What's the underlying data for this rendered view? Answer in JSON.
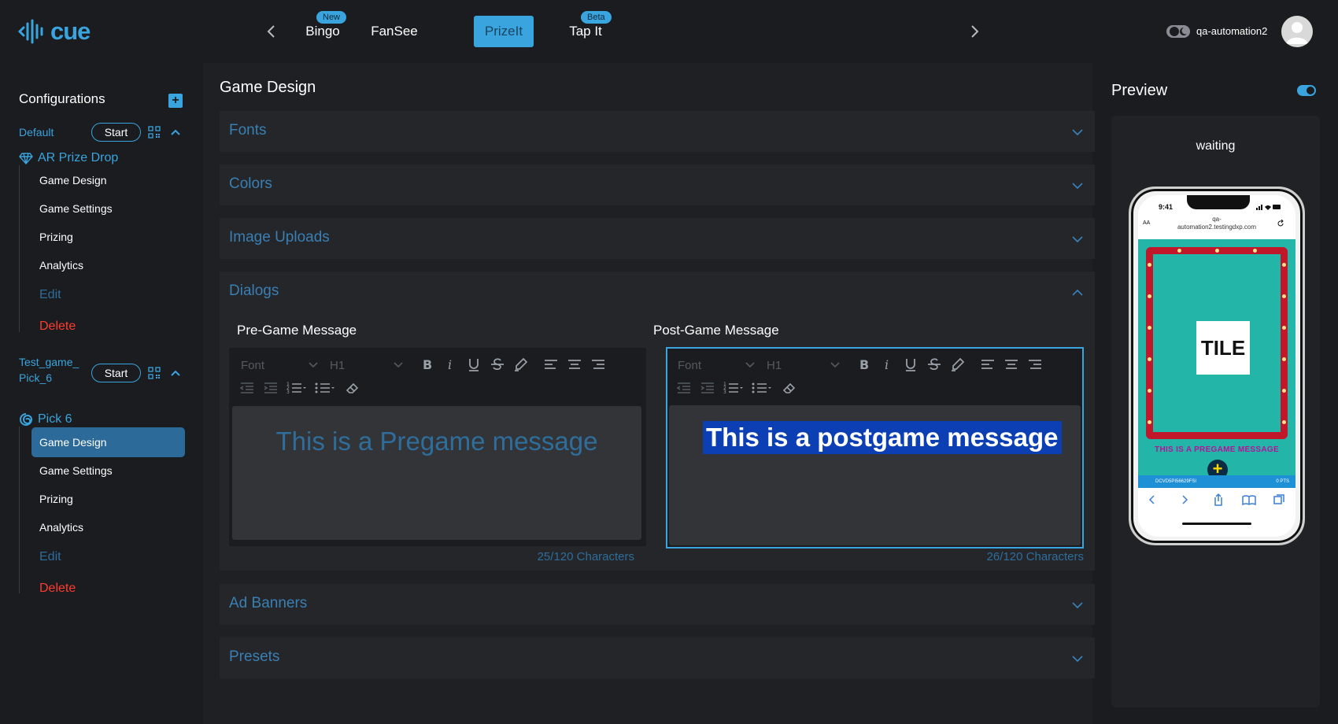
{
  "brand": {
    "name": "cue",
    "color": "#3aa4de"
  },
  "tabs": [
    {
      "label": "Bingo",
      "badge": "New"
    },
    {
      "label": "FanSee",
      "badge": ""
    },
    {
      "label": "PrizeIt",
      "badge": "",
      "active": true
    },
    {
      "label": "Tap It",
      "badge": "Beta"
    }
  ],
  "user": {
    "name": "qa-automation2"
  },
  "sidebar": {
    "title": "Configurations",
    "configs": [
      {
        "name": "Default",
        "start_label": "Start",
        "game_type": "AR Prize Drop",
        "items": [
          "Game Design",
          "Game Settings",
          "Prizing",
          "Analytics"
        ],
        "edit_label": "Edit",
        "delete_label": "Delete"
      },
      {
        "name_line1": "Test_game_",
        "name_line2": "Pick_6",
        "start_label": "Start",
        "game_type": "Pick 6",
        "items": [
          "Game Design",
          "Game Settings",
          "Prizing",
          "Analytics"
        ],
        "active_item": "Game Design",
        "edit_label": "Edit",
        "delete_label": "Delete"
      }
    ]
  },
  "main": {
    "title": "Game Design",
    "sections": {
      "fonts": "Fonts",
      "colors": "Colors",
      "image_uploads": "Image Uploads",
      "dialogs": "Dialogs",
      "ad_banners": "Ad Banners",
      "presets": "Presets"
    },
    "dialogs": {
      "pre": {
        "title": "Pre-Game Message",
        "font_placeholder": "Font",
        "heading": "H1",
        "text": "This is a Pregame message",
        "count": "25/120 Characters"
      },
      "post": {
        "title": "Post-Game Message",
        "font_placeholder": "Font",
        "heading": "H1",
        "text": "This is a postgame message",
        "count": "26/120 Characters"
      }
    }
  },
  "preview": {
    "title": "Preview",
    "status": "waiting",
    "phone": {
      "time": "9:41",
      "url_line1": "qa-",
      "url_line2": "automation2.testingdxp.com",
      "aa": "AA",
      "tile": "TILE",
      "pregame_text": "THIS IS A PREGAME MESSAGE",
      "player_id": "DCVD5PI56629FSI",
      "points": "0 PTS"
    }
  }
}
